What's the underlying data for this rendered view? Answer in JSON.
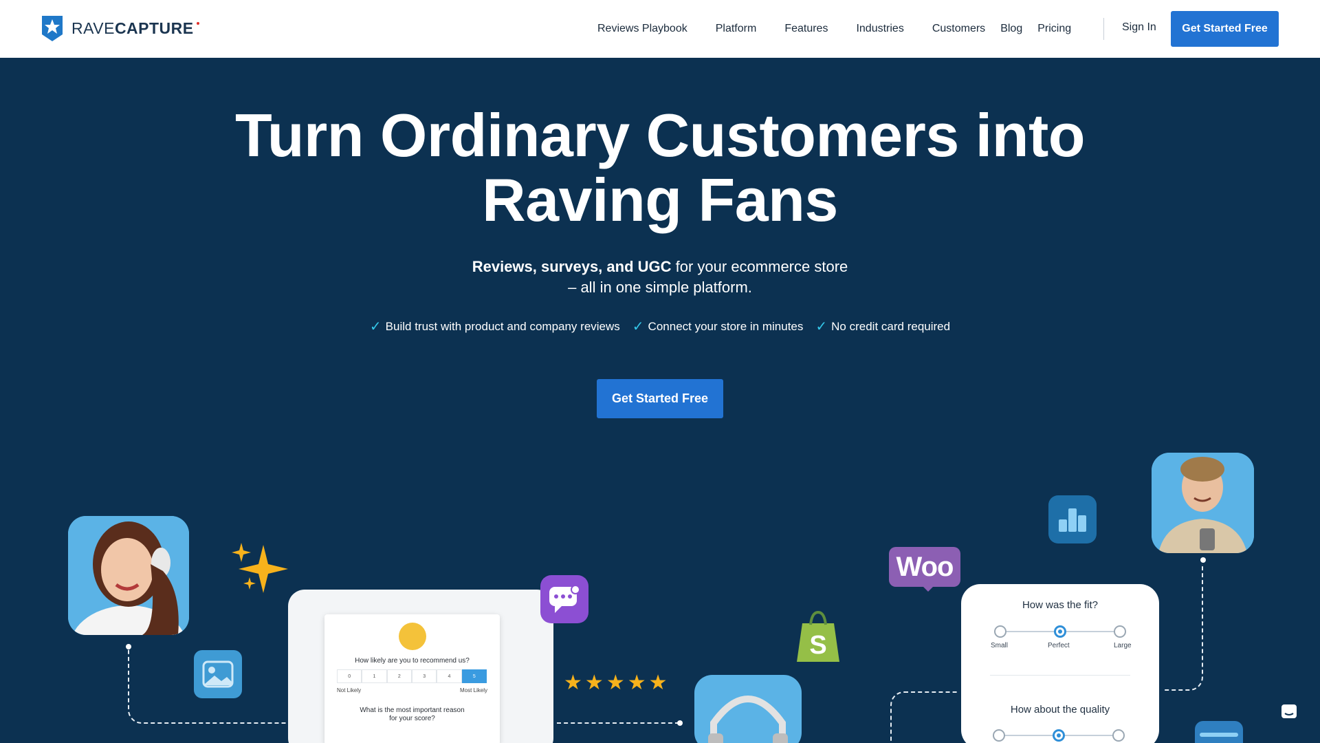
{
  "nav": {
    "logo_light": "RAVE",
    "logo_bold": "CAPTURE",
    "links": [
      "Reviews Playbook",
      "Platform",
      "Features",
      "Industries",
      "Customers",
      "Blog",
      "Pricing"
    ],
    "sign_in": "Sign In",
    "cta": "Get Started Free"
  },
  "hero": {
    "title_line1": "Turn Ordinary Customers into",
    "title_line2": "Raving Fans",
    "sub_bold": "Reviews, surveys, and UGC",
    "sub_rest": " for your ecommerce store",
    "sub_line2": "– all in one simple platform.",
    "checks": [
      "Build trust with product and company reviews",
      "Connect your store in minutes",
      "No credit card required"
    ],
    "cta": "Get Started Free"
  },
  "survey_card": {
    "question": "How likely are you to recommend us?",
    "scale": [
      "0",
      "1",
      "2",
      "3",
      "4",
      "5"
    ],
    "selected": "5",
    "low_label": "Not Likely",
    "high_label": "Most Likely",
    "question2_line1": "What is the most important reason",
    "question2_line2": "for your score?"
  },
  "fit_card": {
    "q1": "How was the fit?",
    "options": [
      "Small",
      "Perfect",
      "Large"
    ],
    "selected": "Perfect",
    "q2": "How about the quality"
  },
  "woo_label": "Woo",
  "rating_stars": 5,
  "icons": [
    "star-logo-icon",
    "check-icon",
    "sparkle-icon",
    "image-icon",
    "chat-icon",
    "shopify-icon",
    "woo-icon",
    "bar-chart-icon",
    "headphones-icon",
    "messenger-icon"
  ],
  "colors": {
    "hero_bg": "#0c3151",
    "primary": "#2273d3",
    "check": "#34c7e9",
    "tile_blue": "#5bb3e6",
    "star": "#f7b21c"
  }
}
